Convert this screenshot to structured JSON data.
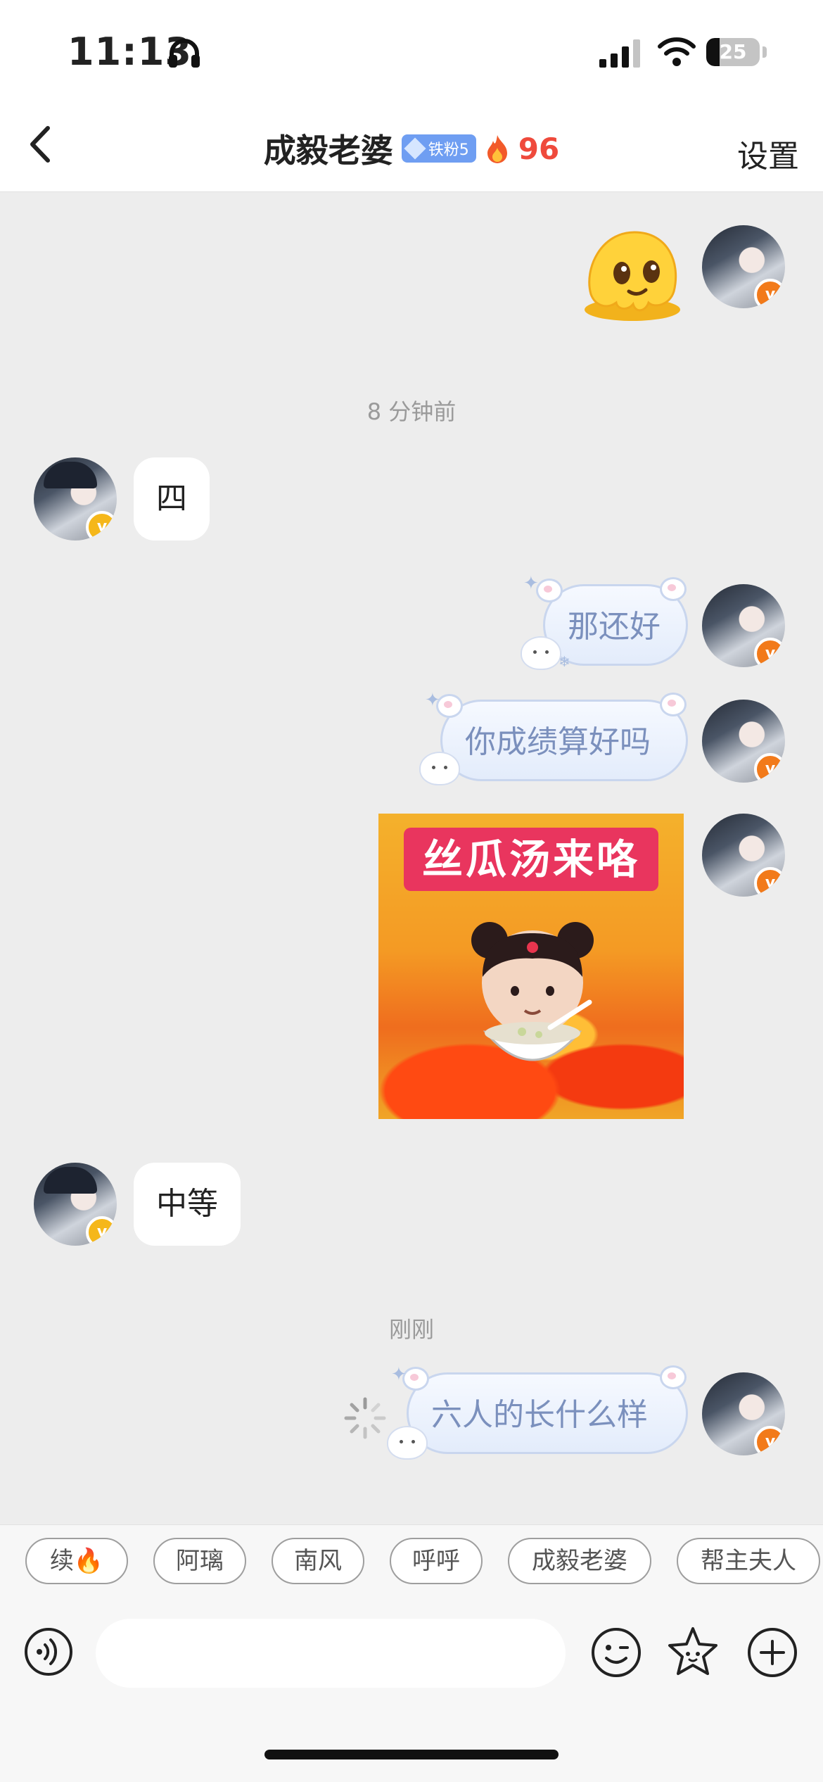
{
  "status_bar": {
    "time": "11:13",
    "battery": "25",
    "battery_level": 0.25
  },
  "header": {
    "title": "成毅老婆",
    "fan_badge": "铁粉5",
    "streak_count": "96",
    "settings_label": "设置"
  },
  "messages": {
    "timestamp_1": "8 分钟前",
    "left_1": "四",
    "right_1": "那还好",
    "right_2": "你成绩算好吗",
    "gif_caption": "丝瓜汤来咯",
    "left_2": "中等",
    "timestamp_2": "刚刚",
    "right_3": "六人的长什么样"
  },
  "quick_replies": [
    {
      "label": "续🔥"
    },
    {
      "label": "阿璃"
    },
    {
      "label": "南风"
    },
    {
      "label": "呼呼"
    },
    {
      "label": "成毅老婆"
    },
    {
      "label": "帮主夫人"
    }
  ],
  "input": {
    "value": "",
    "placeholder": ""
  },
  "colors": {
    "accent_red": "#ef4a3c",
    "badge_blue": "#6f9ef2",
    "bubble_text": "#7b90bd",
    "v_orange": "#f27a1a",
    "v_yellow": "#f5b71a"
  }
}
